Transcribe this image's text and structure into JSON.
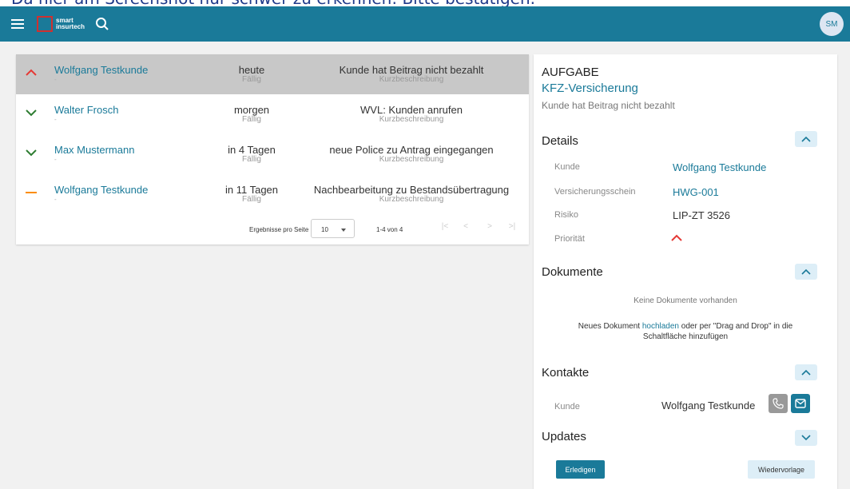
{
  "header_clip": "Da hier am Screenshot nur schwer zu erkennen: Bitte bestätigen.",
  "appbar": {
    "logo_line1": "smart",
    "logo_line2": "insurtech",
    "avatar": "SM",
    "color": "#1a7a99"
  },
  "tasks": [
    {
      "priority": "high",
      "customer": "Wolfgang Testkunde",
      "customer_sub": "-",
      "due": "heute",
      "due_sub": "Fällig",
      "desc": "Kunde hat Beitrag nicht bezahlt",
      "desc_sub": "Kurzbeschreibung"
    },
    {
      "priority": "low",
      "customer": "Walter Frosch",
      "customer_sub": "-",
      "due": "morgen",
      "due_sub": "Fällig",
      "desc": "WVL: Kunden anrufen",
      "desc_sub": "Kurzbeschreibung"
    },
    {
      "priority": "low",
      "customer": "Max Mustermann",
      "customer_sub": "-",
      "due": "in 4 Tagen",
      "due_sub": "Fällig",
      "desc": "neue Police zu Antrag eingegangen",
      "desc_sub": "Kurzbeschreibung"
    },
    {
      "priority": "medium",
      "customer": "Wolfgang Testkunde",
      "customer_sub": "-",
      "due": "in 11 Tagen",
      "due_sub": "Fällig",
      "desc": "Nachbearbeitung zu Bestandsübertragung",
      "desc_sub": "Kurzbeschreibung"
    }
  ],
  "pager": {
    "label": "Ergebnisse pro Seite",
    "per_page": "10",
    "range": "1-4 von 4",
    "first": "|<",
    "prev": "<",
    "next": ">",
    "last": ">|"
  },
  "detail": {
    "kind": "AUFGABE",
    "title": "KFZ-Versicherung",
    "subtitle": "Kunde hat Beitrag nicht bezahlt",
    "details_title": "Details",
    "rows": [
      {
        "label": "Kunde",
        "value": "Wolfgang Testkunde"
      },
      {
        "label": "Versicherungsschein",
        "value": "HWG-001"
      },
      {
        "label": "Risiko",
        "value": "LIP-ZT 3526"
      },
      {
        "label": "Priorität",
        "value": ""
      }
    ],
    "documents_title": "Dokumente",
    "no_documents": "Keine Dokumente vorhanden",
    "upload_prefix": "Neues Dokument ",
    "upload_link": "hochladen",
    "upload_suffix": " oder per \"Drag and Drop\" in die Schaltfläche hinzufügen",
    "contacts_title": "Kontakte",
    "contact_label": "Kunde",
    "contact_name": "Wolfgang Testkunde",
    "updates_title": "Updates",
    "btn_done": "Erledigen",
    "btn_resubmit": "Wiedervorlage"
  },
  "colors": {
    "high": "#e53935",
    "low": "#2e7d32",
    "medium": "#fb8c00",
    "accent": "#1a7a99"
  }
}
